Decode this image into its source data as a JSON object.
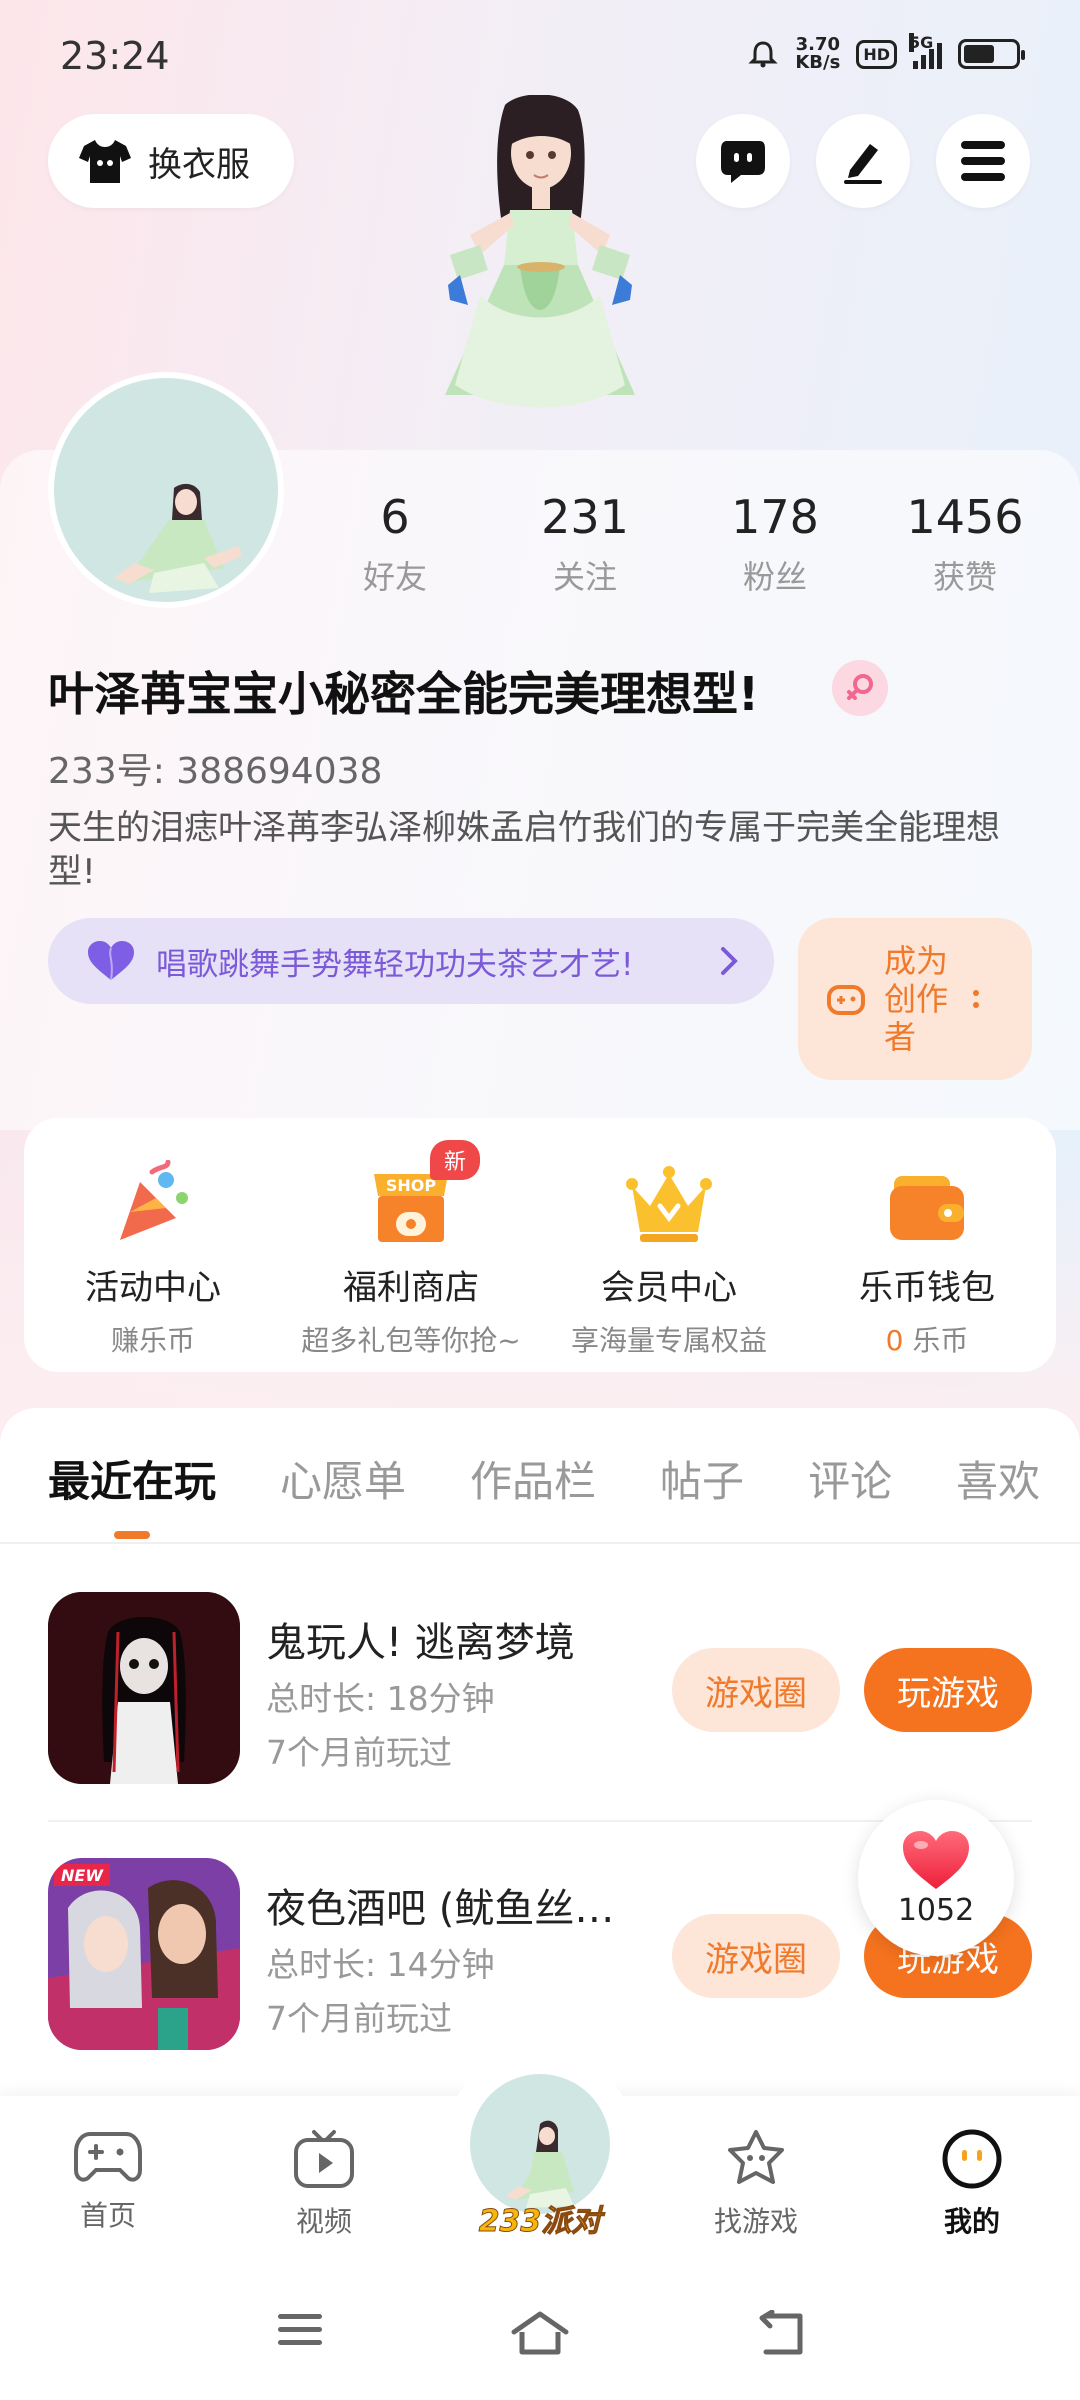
{
  "status_bar": {
    "time": "23:24",
    "net_speed_value": "3.70",
    "net_speed_unit": "KB/s",
    "hd": "HD",
    "network": "5G",
    "battery_level": 0.6
  },
  "header": {
    "outfit_label": "换衣服",
    "buttons": [
      "chat-icon",
      "edit-icon",
      "menu-icon"
    ]
  },
  "profile": {
    "stats": [
      {
        "value": "6",
        "label": "好友"
      },
      {
        "value": "231",
        "label": "关注"
      },
      {
        "value": "178",
        "label": "粉丝"
      },
      {
        "value": "1456",
        "label": "获赞"
      }
    ],
    "nickname": "叶泽苒宝宝小秘密全能完美理想型!",
    "id_text": "233号: 388694038",
    "bio": "天生的泪痣叶泽苒李弘泽柳姝孟启竹我们的专属于完美全能理想型!",
    "tag": "唱歌跳舞手势舞轻功功夫茶艺才艺!",
    "creator_label": "成为创作者"
  },
  "features": [
    {
      "title": "活动中心",
      "sub": "赚乐币",
      "icon": "party-popper-icon"
    },
    {
      "title": "福利商店",
      "sub": "超多礼包等你抢~",
      "icon": "shop-icon",
      "badge": "新"
    },
    {
      "title": "会员中心",
      "sub": "享海量专属权益",
      "icon": "crown-icon"
    },
    {
      "title": "乐币钱包",
      "sub_value": "0",
      "sub_unit": "乐币",
      "icon": "wallet-icon"
    }
  ],
  "tabs": [
    "最近在玩",
    "心愿单",
    "作品栏",
    "帖子",
    "评论",
    "喜欢"
  ],
  "games": [
    {
      "title": "鬼玩人! 逃离梦境",
      "duration": "总时长: 18分钟",
      "last_played": "7个月前玩过",
      "circle_btn": "游戏圈",
      "play_btn": "玩游戏"
    },
    {
      "title": "夜色酒吧 (鱿鱼丝…",
      "duration": "总时长: 14分钟",
      "last_played": "7个月前玩过",
      "circle_btn": "游戏圈",
      "play_btn": "玩游戏"
    }
  ],
  "like_count": "1052",
  "bottom_nav": [
    {
      "label": "首页",
      "icon": "gamepad-icon"
    },
    {
      "label": "视频",
      "icon": "tv-icon"
    },
    {
      "label": "233派对",
      "icon": "party-avatar"
    },
    {
      "label": "找游戏",
      "icon": "star-icon"
    },
    {
      "label": "我的",
      "icon": "face-icon"
    }
  ],
  "colors": {
    "accent": "#f5731e",
    "accent_light": "#fde5d8",
    "tag_purple": "#7a5ad8",
    "badge_red": "#f04848"
  }
}
